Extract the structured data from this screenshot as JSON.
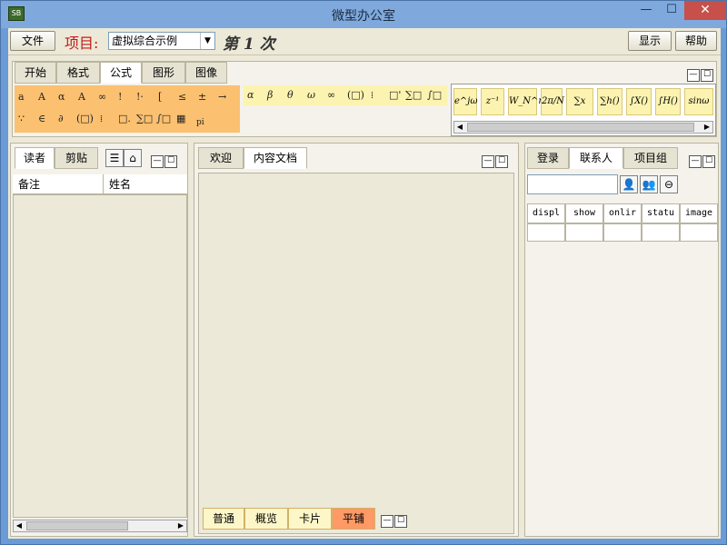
{
  "window": {
    "title": "微型办公室",
    "minimize": "—",
    "maximize": "☐",
    "close": "✕",
    "icon_label": "SB"
  },
  "toolbar": {
    "file": "文件",
    "project_label": "项目:",
    "project_value": "虚拟综合示例",
    "step_text": "第 1 次",
    "show": "显示",
    "help": "帮助"
  },
  "ribbon": {
    "tabs": [
      "开始",
      "格式",
      "公式",
      "图形",
      "图像"
    ],
    "active_tab": "公式",
    "symbols_row1": [
      "a",
      "A",
      "α",
      "Α",
      "∞",
      "!",
      "!·",
      "[",
      "≤",
      "±",
      "→"
    ],
    "symbols_row2": [
      "∵",
      "∈",
      "∂",
      "(□)",
      "⁞",
      "□.",
      "∑□",
      "∫□",
      "▦",
      "pi"
    ],
    "greek": [
      "α",
      "β",
      "θ",
      "ω",
      "∞",
      "(□)",
      "⁞",
      "□'",
      "∑□",
      "∫□"
    ],
    "formulas": [
      "e^jω",
      "z⁻¹",
      "W_N^nk",
      "2π/N",
      "∑x",
      "∑h()",
      "∫X()",
      "∫H()",
      "sinω"
    ]
  },
  "left_panel": {
    "tabs": [
      "读者",
      "剪贴"
    ],
    "columns": [
      "备注",
      "姓名"
    ],
    "list_icon": "list-icon",
    "tray_icon": "tray-icon"
  },
  "center_panel": {
    "tabs": [
      "欢迎",
      "内容文档"
    ],
    "view_tabs": [
      "普通",
      "概览",
      "卡片",
      "平铺"
    ],
    "selected_view": "平铺"
  },
  "right_panel": {
    "tabs": [
      "登录",
      "联系人",
      "项目组"
    ],
    "columns": [
      "displ",
      "show",
      "onlir",
      "statu",
      "image"
    ],
    "search_value": ""
  },
  "colors": {
    "title_bar": "#7fa9dd",
    "client": "#ece9d8",
    "ribbon_symbols": "#fbc070",
    "ribbon_greek": "#fcf3b0",
    "selected_view": "#ff9966",
    "project_label": "#c41a1a"
  }
}
